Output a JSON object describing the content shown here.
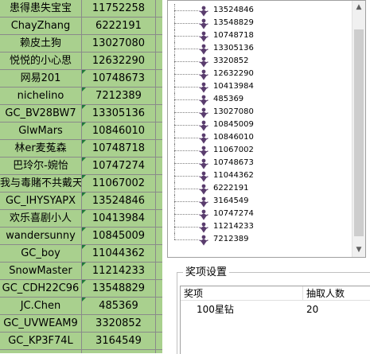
{
  "sheet": {
    "rows": [
      {
        "name": "患得患失宝宝",
        "id": "11752258"
      },
      {
        "name": "ChayZhang",
        "id": "6222191"
      },
      {
        "name": "赖皮土狗",
        "id": "13027080"
      },
      {
        "name": "悦悦的小心思",
        "id": "12632290"
      },
      {
        "name": "网易201",
        "id": "10748673"
      },
      {
        "name": "nichelino",
        "id": "7212389"
      },
      {
        "name": "GC_BV28BW7",
        "id": "13305136"
      },
      {
        "name": "GlwMars",
        "id": "10846010"
      },
      {
        "name": "林er麦菟森",
        "id": "10748718"
      },
      {
        "name": "巴玲尔-婉怡",
        "id": "10747274"
      },
      {
        "name": "我与毒賭不共戴天",
        "id": "11067002"
      },
      {
        "name": "GC_IHYSYAPX",
        "id": "13524846"
      },
      {
        "name": "欢乐喜剧小人",
        "id": "10413984"
      },
      {
        "name": "wandersunny",
        "id": "10845009"
      },
      {
        "name": "GC_boy",
        "id": "11044362"
      },
      {
        "name": "SnowMaster",
        "id": "11214233"
      },
      {
        "name": "GC_CDH22C96",
        "id": "13548829"
      },
      {
        "name": "JC.Chen",
        "id": "485369"
      },
      {
        "name": "GC_UVWEAM9",
        "id": "3320852"
      },
      {
        "name": "GC_KP3F74L",
        "id": "3164549"
      },
      {
        "name": "",
        "id": ""
      }
    ]
  },
  "tree": {
    "items": [
      "13524846",
      "13548829",
      "10748718",
      "13305136",
      "3320852",
      "12632290",
      "10413984",
      "485369",
      "13027080",
      "10845009",
      "10846010",
      "11067002",
      "10748673",
      "11044362",
      "6222191",
      "3164549",
      "10747274",
      "11214233",
      "7212389"
    ],
    "icon": "user-figure-icon"
  },
  "scrollbar": {
    "up_icon": "arrow-up-icon",
    "down_icon": "arrow-down-icon"
  },
  "award": {
    "legend": "奖项设置",
    "columns": {
      "item": "奖项",
      "count": "抽取人数"
    },
    "rows": [
      {
        "item": "100星钻",
        "count": "20"
      }
    ]
  },
  "colors": {
    "sheet_bg": "#a9d08e",
    "tree_icon": "#5a3d6e"
  }
}
